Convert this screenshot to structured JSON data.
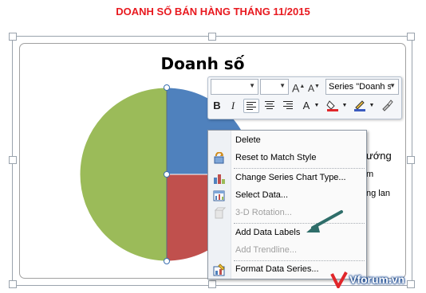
{
  "page_title": "DOANH SỐ BÁN HÀNG THÁNG 11/2015",
  "chart": {
    "title": "Doanh số",
    "legend_fragments": [
      "ướng",
      "m",
      "ng lan"
    ],
    "colors": {
      "slice_blue": "#4f81bd",
      "slice_red": "#c0504d",
      "slice_green": "#9bbb59"
    }
  },
  "chart_data": {
    "type": "pie",
    "title": "Doanh số",
    "values": [
      25,
      25,
      50
    ],
    "colors": [
      "#4f81bd",
      "#c0504d",
      "#9bbb59"
    ]
  },
  "mini_toolbar": {
    "font_name": "",
    "font_size": "",
    "series_selector": "Series \"Doanh s",
    "grow_font": "A",
    "shrink_font": "A",
    "bold": "B",
    "italic": "I",
    "font_color_letter": "A"
  },
  "context_menu": {
    "items": [
      {
        "label": "Delete",
        "disabled": false
      },
      {
        "label": "Reset to Match Style",
        "disabled": false
      },
      {
        "label": "Change Series Chart Type...",
        "disabled": false
      },
      {
        "label": "Select Data...",
        "disabled": false
      },
      {
        "label": "3-D Rotation...",
        "disabled": true
      },
      {
        "label": "Add Data Labels",
        "disabled": false
      },
      {
        "label": "Add Trendline...",
        "disabled": true
      },
      {
        "label": "Format Data Series...",
        "disabled": false
      }
    ]
  },
  "watermark": {
    "text": "Vforum.vn"
  }
}
